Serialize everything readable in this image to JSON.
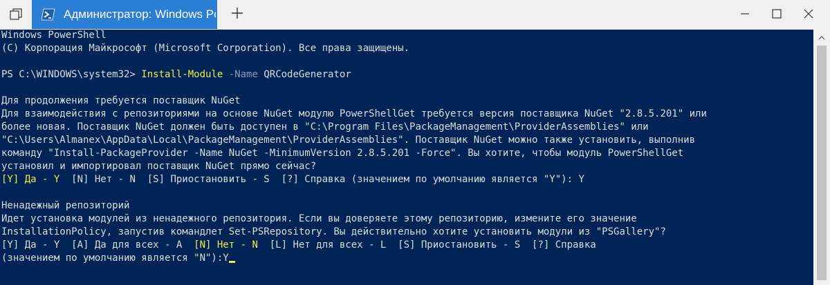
{
  "window": {
    "tab_title": "Администратор: Windows PowerShell"
  },
  "icons": {
    "restore": "tab-restore-icon",
    "powershell": "powershell-icon",
    "new_tab": "plus-icon",
    "minimize": "minimize-icon",
    "maximize": "maximize-icon",
    "close": "close-icon",
    "scroll_up": "chevron-up-icon"
  },
  "colors": {
    "console_bg": "#012456",
    "console_text": "#dcdcdc",
    "accent_yellow": "#f0eb4a",
    "param_gray": "#8a9bb0",
    "tab_blue": "#2a7fd4"
  },
  "console": {
    "header1": "Windows PowerShell",
    "header2": "(C) Корпорация Майкрософт (Microsoft Corporation). Все права защищены.",
    "prompt": "PS C:\\WINDOWS\\system32> ",
    "cmd_name": "Install-Module",
    "cmd_param": "-Name",
    "cmd_value": "QRCodeGenerator",
    "nuget_title": "Для продолжения требуется поставщик NuGet",
    "nuget_lines": [
      "Для взаимодействия с репозиториями на основе NuGet модулю PowerShellGet требуется версия поставщика NuGet \"2.8.5.201\" или",
      "более новая. Поставщик NuGet должен быть доступен в \"C:\\Program Files\\PackageManagement\\ProviderAssemblies\" или",
      "\"C:\\Users\\Almanex\\AppData\\Local\\PackageManagement\\ProviderAssemblies\". Поставщик NuGet можно также установить, выполнив",
      "команду \"Install-PackageProvider -Name NuGet -MinimumVersion 2.8.5.201 -Force\". Вы хотите, чтобы модуль PowerShellGet",
      "установил и импортировал поставщик NuGet прямо сейчас?"
    ],
    "choice1_yes": "[Y] Да - Y",
    "choice1_rest": "  [N] Нет - N  [S] Приостановить - S  [?] Справка (значением по умолчанию является \"Y\"): Y",
    "repo_title": "Ненадежный репозиторий",
    "repo_lines": [
      "Идет установка модулей из ненадежного репозитория. Если вы доверяете этому репозиторию, измените его значение",
      "InstallationPolicy, запустив командлет Set-PSRepository. Вы действительно хотите установить модули из \"PSGallery\"?"
    ],
    "choice2_start": "[Y] Да - Y  [A] Да для всех - A  ",
    "choice2_no": "[N] Нет - N",
    "choice2_rest": "  [L] Нет для всех - L  [S] Приостановить - S  [?] Справка",
    "final_line": "(значением по умолчанию является \"N\"):Y"
  }
}
